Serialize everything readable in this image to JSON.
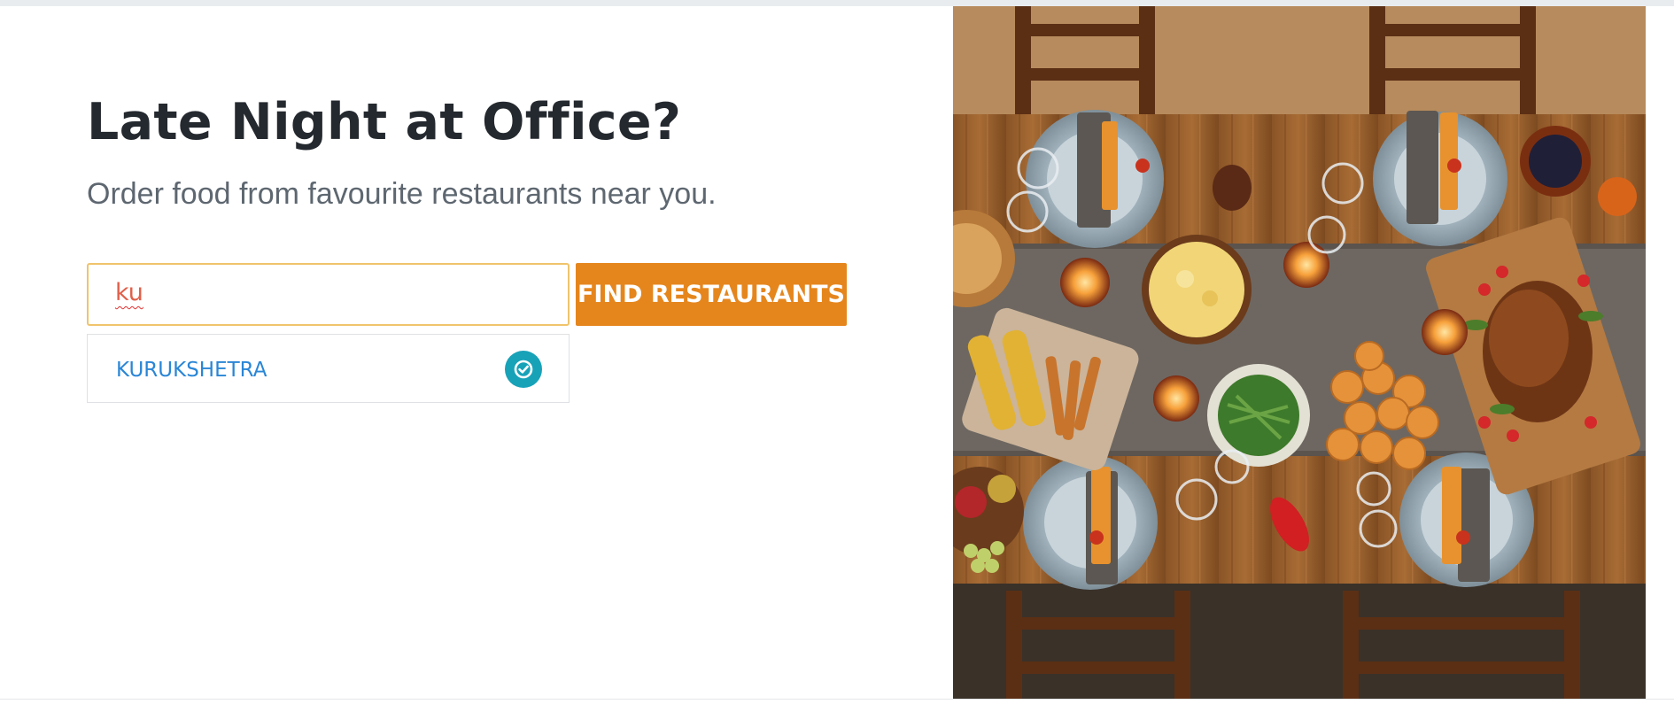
{
  "hero": {
    "title": "Late Night at Office?",
    "subtitle": "Order food from favourite restaurants near you."
  },
  "search": {
    "value": "ku",
    "button_label": "FIND RESTAURANTS"
  },
  "suggestions": [
    {
      "label": "KURUKSHETRA",
      "selected": true
    }
  ],
  "colors": {
    "accent": "#e5861d",
    "link": "#2a86d6",
    "check": "#17a2b8",
    "input_focus_border": "#f0c46c"
  },
  "icons": {
    "suggestion_selected": "check-circle-icon"
  },
  "image": {
    "subject": "overhead view of a festive dinner table with roast turkey, plates and candles"
  }
}
